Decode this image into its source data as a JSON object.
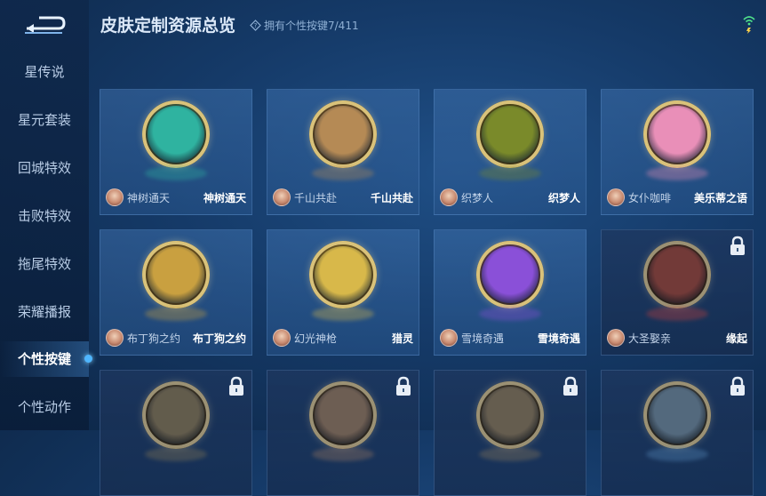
{
  "header": {
    "title": "皮肤定制资源总览",
    "owned_label": "拥有个性按键7/411"
  },
  "sidebar": {
    "items": [
      {
        "label": "星传说"
      },
      {
        "label": "星元套装"
      },
      {
        "label": "回城特效"
      },
      {
        "label": "击败特效"
      },
      {
        "label": "拖尾特效"
      },
      {
        "label": "荣耀播报"
      },
      {
        "label": "个性按键",
        "active": true
      },
      {
        "label": "个性动作"
      }
    ]
  },
  "cards": [
    {
      "skin": "神树通天",
      "button": "神树通天",
      "icon": "teal-bird-emblem-icon",
      "color": "#2fb3a0",
      "locked": false
    },
    {
      "skin": "千山共赴",
      "button": "千山共赴",
      "icon": "golden-sword-emblem-icon",
      "color": "#b58a55",
      "locked": false
    },
    {
      "skin": "织梦人",
      "button": "织梦人",
      "icon": "green-dragon-emblem-icon",
      "color": "#7a8a2a",
      "locked": false
    },
    {
      "skin": "女仆咖啡",
      "button": "美乐蒂之语",
      "icon": "pink-bunny-emblem-icon",
      "color": "#e98fb8",
      "locked": false
    },
    {
      "skin": "布丁狗之约",
      "button": "布丁狗之约",
      "icon": "yellow-bow-emblem-icon",
      "color": "#c9a040",
      "locked": false
    },
    {
      "skin": "幻光神枪",
      "button": "猎灵",
      "icon": "spear-emblem-icon",
      "color": "#d8b84a",
      "locked": false
    },
    {
      "skin": "雪境奇遇",
      "button": "雪境奇遇",
      "icon": "purple-flower-emblem-icon",
      "color": "#8a50d8",
      "locked": false
    },
    {
      "skin": "大圣娶亲",
      "button": "缘起",
      "icon": "red-scroll-emblem-icon",
      "color": "#c8403c",
      "locked": true
    },
    {
      "skin": "",
      "button": "",
      "icon": "locked-emblem-icon",
      "color": "#8a7a55",
      "locked": true
    },
    {
      "skin": "",
      "button": "",
      "icon": "locked-emblem-icon",
      "color": "#a07a60",
      "locked": true
    },
    {
      "skin": "",
      "button": "",
      "icon": "locked-emblem-icon",
      "color": "#8f7b5a",
      "locked": true
    },
    {
      "skin": "",
      "button": "",
      "icon": "locked-emblem-icon",
      "color": "#5a8fc0",
      "locked": true
    }
  ]
}
